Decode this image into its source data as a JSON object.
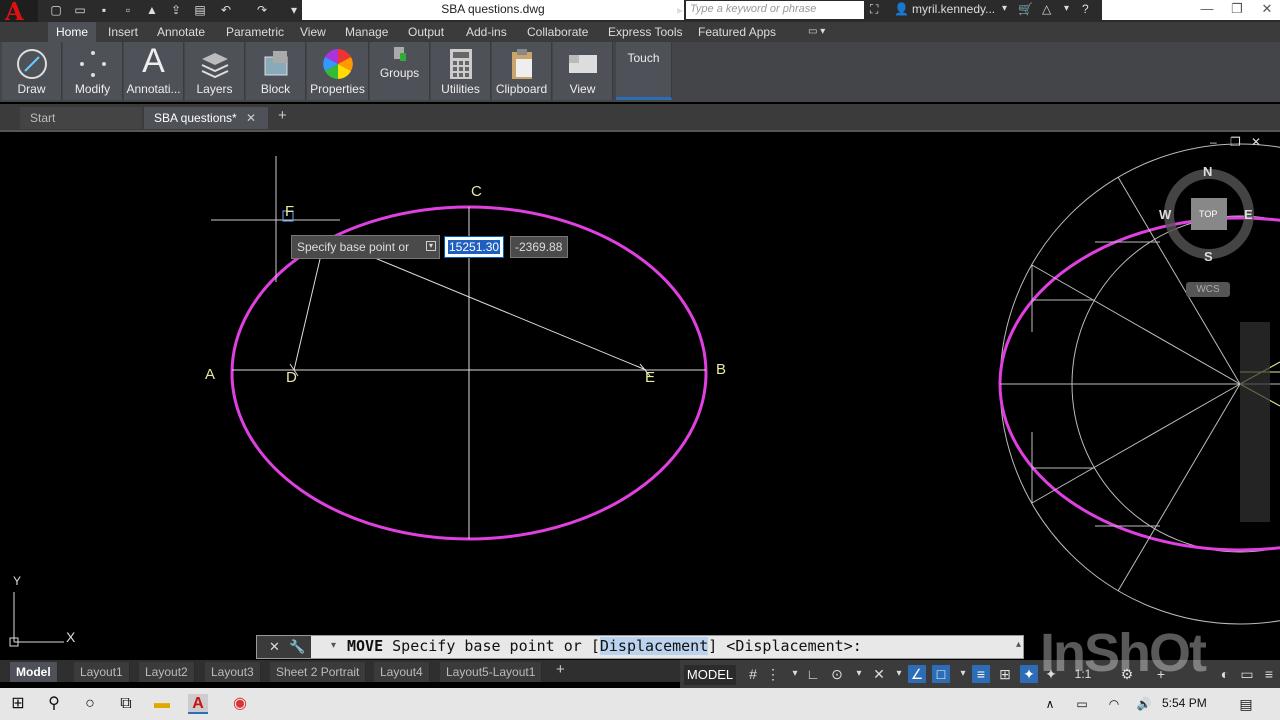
{
  "app": {
    "logo_letter": "A",
    "document_title": "SBA questions.dwg",
    "search_placeholder": "Type a keyword or phrase",
    "user_name": "myril.kennedy..."
  },
  "ribbon_tabs": [
    "Home",
    "Insert",
    "Annotate",
    "Parametric",
    "View",
    "Manage",
    "Output",
    "Add-ins",
    "Collaborate",
    "Express Tools",
    "Featured Apps"
  ],
  "ribbon_panels": [
    "Draw",
    "Modify",
    "Annotati...",
    "Layers",
    "Block",
    "Properties",
    "Groups",
    "Utilities",
    "Clipboard",
    "View",
    "Touch"
  ],
  "doc_tabs": {
    "start": "Start",
    "active": "SBA questions*"
  },
  "drawing": {
    "point_labels": {
      "a": "A",
      "b": "B",
      "c": "C",
      "d": "D",
      "e": "E",
      "f": "F"
    },
    "ellipse_color": "#e040e0",
    "viewcube": {
      "n": "N",
      "s": "S",
      "e": "E",
      "w": "W",
      "top": "TOP",
      "wcs": "WCS"
    },
    "ucs": {
      "x": "X",
      "y": "Y"
    }
  },
  "dynamic_input": {
    "prompt": "Specify base point or",
    "x_value": "15251.30",
    "y_value": "-2369.88"
  },
  "command_line": {
    "command": "MOVE",
    "prompt_start": "Specify base point or [",
    "option_hotkey": "D",
    "option_rest": "isplacement",
    "prompt_end": "] <Displacement>:"
  },
  "layout_tabs": [
    "Model",
    "Layout1",
    "Layout2",
    "Layout3",
    "Sheet 2 Portrait",
    "Layout4",
    "Layout5-Layout1"
  ],
  "status": {
    "model": "MODEL",
    "scale": "1:1"
  },
  "watermark": "InShOt",
  "taskbar": {
    "time": "5:54 PM"
  }
}
